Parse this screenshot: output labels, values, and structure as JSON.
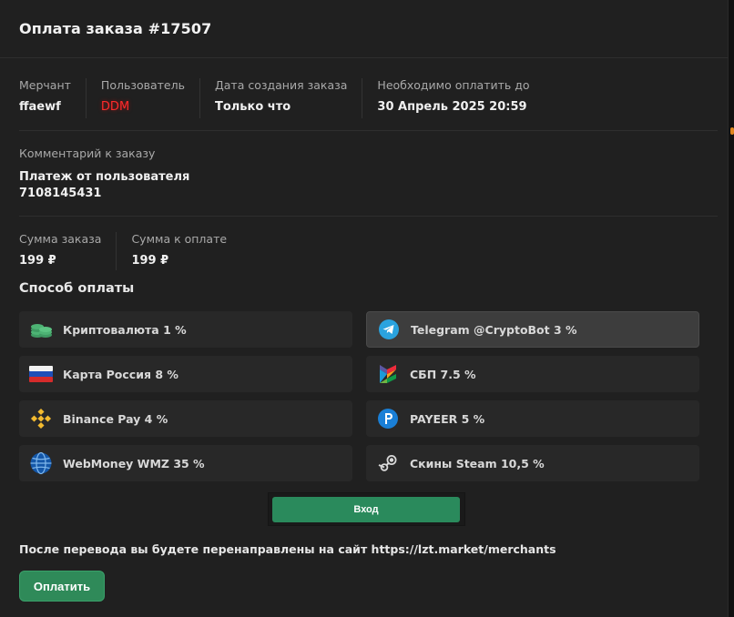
{
  "title": "Оплата заказа #17507",
  "info": [
    {
      "label": "Мерчант",
      "value": "ffaewf"
    },
    {
      "label": "Пользователь",
      "value": "DDM"
    },
    {
      "label": "Дата создания заказа",
      "value": "Только что"
    },
    {
      "label": "Необходимо оплатить до",
      "value": "30 Апрель 2025 20:59"
    }
  ],
  "comment": {
    "label": "Комментарий к заказу",
    "line1": "Платеж от пользователя",
    "line2": "7108145431"
  },
  "sums": [
    {
      "label": "Сумма заказа",
      "value": "199 ₽"
    },
    {
      "label": "Сумма к оплате",
      "value": "199 ₽"
    }
  ],
  "payment_section_title": "Способ оплаты",
  "methods": [
    {
      "label": "Криптовалюта 1 %",
      "icon": "crypto-coins-icon",
      "selected": false
    },
    {
      "label": "Telegram @CryptoBot 3 %",
      "icon": "telegram-icon",
      "selected": true
    },
    {
      "label": "Карта Россия 8 %",
      "icon": "russia-flag-icon",
      "selected": false
    },
    {
      "label": "СБП 7.5 %",
      "icon": "sbp-icon",
      "selected": false
    },
    {
      "label": "Binance Pay 4 %",
      "icon": "binance-icon",
      "selected": false
    },
    {
      "label": "PAYEER 5 %",
      "icon": "payeer-icon",
      "selected": false
    },
    {
      "label": "WebMoney WMZ 35 %",
      "icon": "webmoney-icon",
      "selected": false
    },
    {
      "label": "Скины Steam 10,5 %",
      "icon": "steam-icon",
      "selected": false
    }
  ],
  "captcha_button": "Вход",
  "redirect_text": "После перевода вы будете перенаправлены на сайт https://lzt.market/merchants",
  "pay_button": "Оплатить",
  "colors": {
    "background": "#202020",
    "accent_green": "#2f8a59",
    "user_red": "#ff2b2b"
  }
}
